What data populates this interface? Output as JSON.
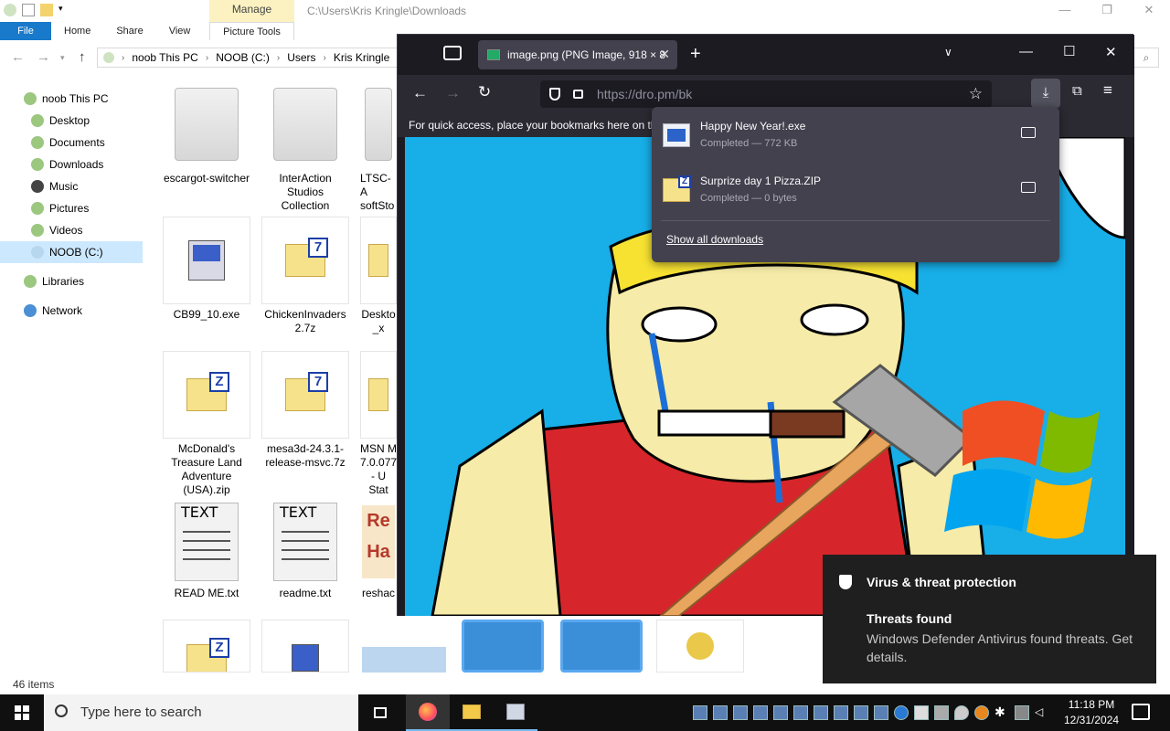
{
  "explorer": {
    "ribbon_context": "Manage",
    "title_path": "C:\\Users\\Kris Kringle\\Downloads",
    "tabs": {
      "file": "File",
      "home": "Home",
      "share": "Share",
      "view": "View",
      "picture_tools": "Picture Tools"
    },
    "address": {
      "c1": "noob This PC",
      "c2": "NOOB (C:)",
      "c3": "Users",
      "c4": "Kris Kringle"
    },
    "nav": {
      "this_pc": "noob This PC",
      "desktop": "Desktop",
      "documents": "Documents",
      "downloads": "Downloads",
      "music": "Music",
      "pictures": "Pictures",
      "videos": "Videos",
      "noob_c": "NOOB (C:)",
      "libraries": "Libraries",
      "network": "Network"
    },
    "files": {
      "f1": "escargot-switcher",
      "f2": "InterAction Studios Collection",
      "f3": "LTSC-A softSto",
      "f4": "CB99_10.exe",
      "f5": "ChickenInvaders 2.7z",
      "f6": "Deskto _x",
      "f7": "McDonald's Treasure Land Adventure (USA).zip",
      "f8": "mesa3d-24.3.1-release-msvc.7z",
      "f9": "MSN M 7.0.077 - U Stat",
      "f10": "READ ME.txt",
      "f11": "readme.txt",
      "f12": "reshac"
    },
    "status": "46 items"
  },
  "firefox": {
    "tab_title": "image.png (PNG Image, 918 × 8",
    "url": "https://dro.pm/bk",
    "bookmarks_hint": "For quick access, place your bookmarks here on th"
  },
  "downloads": {
    "items": [
      {
        "name": "Happy New Year!.exe",
        "status": "Completed — 772 KB"
      },
      {
        "name": "Surprize day 1 Pizza.ZIP",
        "status": "Completed — 0 bytes"
      }
    ],
    "show_all": "Show all downloads"
  },
  "toast": {
    "title": "Virus & threat protection",
    "heading": "Threats found",
    "body": "Windows Defender Antivirus found threats. Get details."
  },
  "taskbar": {
    "search_placeholder": "Type here to search",
    "time": "11:18 PM",
    "date": "12/31/2024"
  },
  "colors": {
    "explorer_accent": "#1979ca",
    "manage_tab": "#fcf1c1",
    "firefox_bg": "#1c1b22",
    "firefox_toolbar": "#2b2a33",
    "downloads_panel": "#42414d",
    "image_sky": "#18aee8",
    "toast_bg": "#1f1f1f",
    "taskbar_bg": "#101010"
  }
}
